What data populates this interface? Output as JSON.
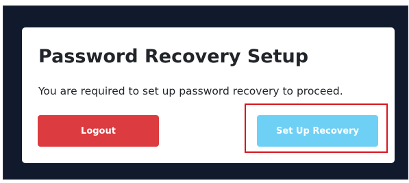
{
  "dialog": {
    "title": "Password Recovery Setup",
    "message": "You are required to set up password recovery to proceed.",
    "logout_label": "Logout",
    "setup_recovery_label": "Set Up Recovery"
  },
  "colors": {
    "backdrop": "#101a2c",
    "logout_button": "#dc3b3f",
    "setup_button": "#6fd0f5",
    "highlight_border": "#d9141c"
  }
}
